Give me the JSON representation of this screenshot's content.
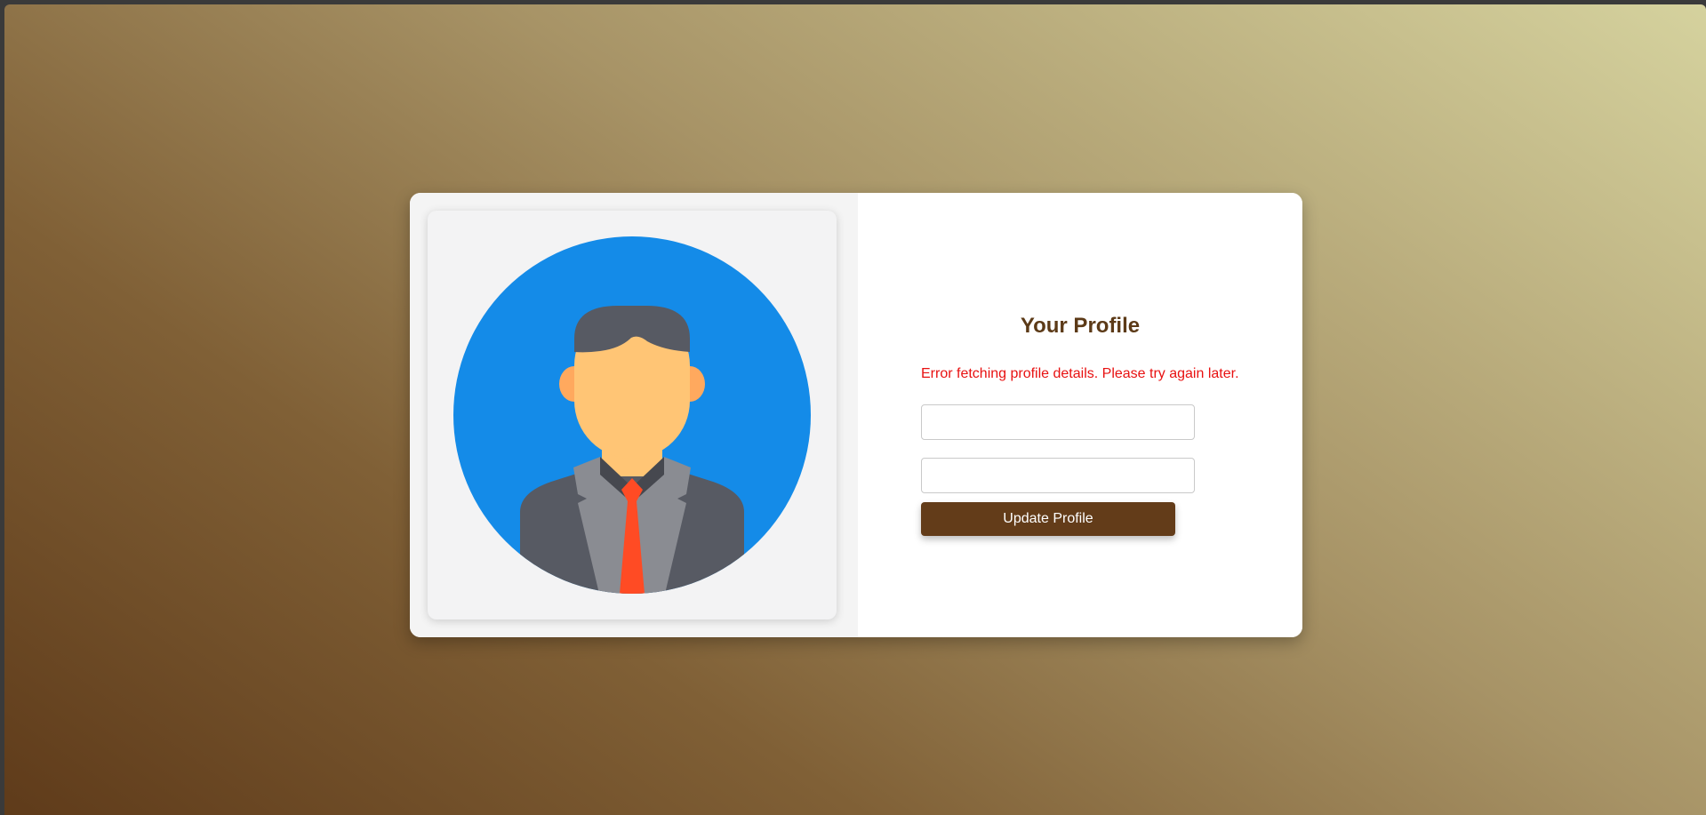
{
  "profile": {
    "title": "Your Profile",
    "error_message": "Error fetching profile details. Please try again later.",
    "field_1": {
      "value": "",
      "placeholder": ""
    },
    "field_2": {
      "value": "",
      "placeholder": ""
    },
    "update_button_label": "Update Profile"
  },
  "avatar": {
    "icon": "user-avatar-icon"
  },
  "colors": {
    "accent": "#633c19",
    "title": "#5c3a17",
    "error": "#e81111",
    "avatar_background": "#148be8",
    "tie": "#ff4b24"
  }
}
